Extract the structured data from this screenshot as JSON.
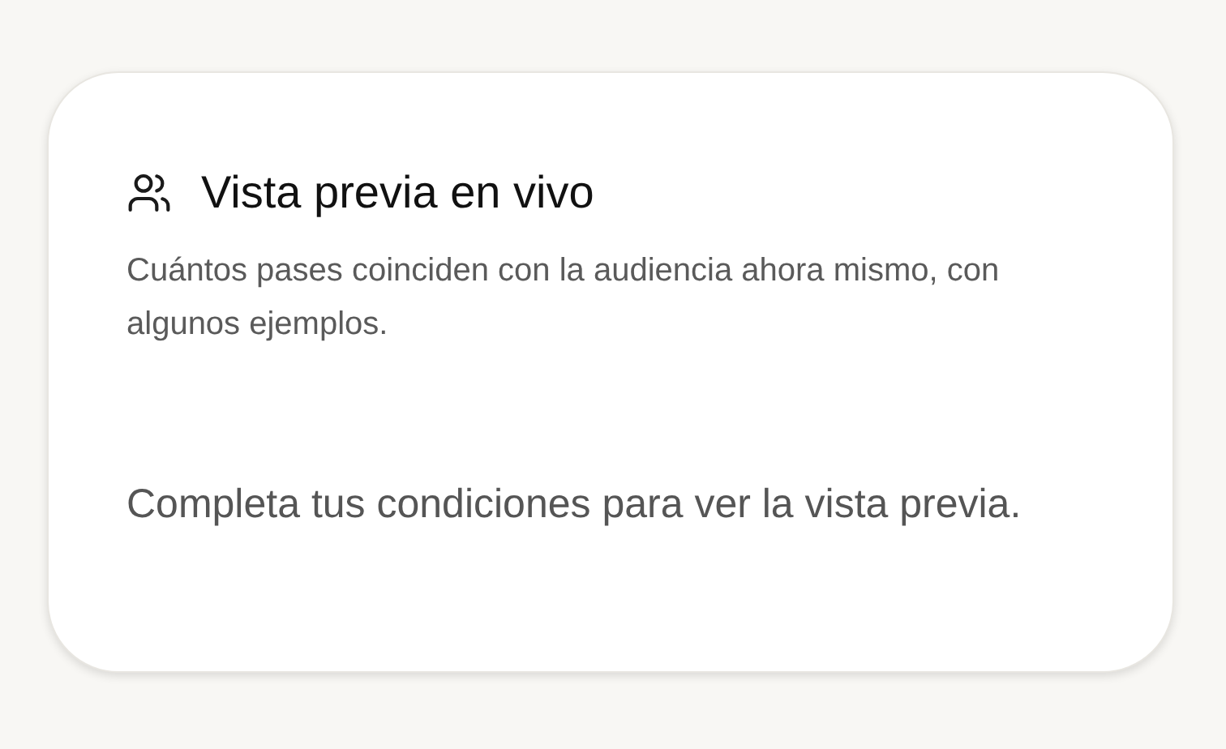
{
  "card": {
    "title": "Vista previa en vivo",
    "description": "Cuántos pases coinciden con la audiencia ahora mismo, con algunos ejemplos.",
    "empty_message": "Completa tus condiciones para ver la vista previa."
  }
}
